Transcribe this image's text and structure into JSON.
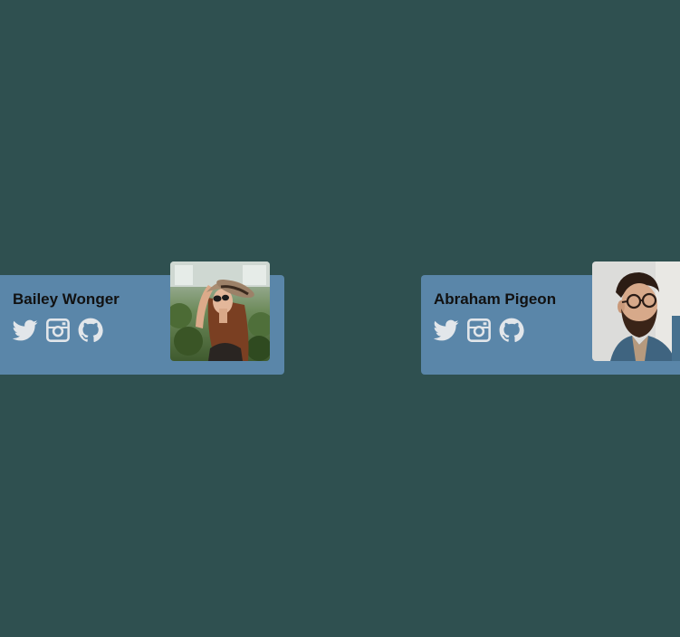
{
  "colors": {
    "background": "#2f5050",
    "card": "#5a86a9",
    "icon": "#e2e6ea",
    "name_text": "#111111"
  },
  "cards": [
    {
      "name": "Bailey Wonger",
      "socials": [
        "twitter-icon",
        "instagram-icon",
        "github-icon"
      ],
      "avatar": "woman-in-hat-photo"
    },
    {
      "name": "Abraham Pigeon",
      "socials": [
        "twitter-icon",
        "instagram-icon",
        "github-icon"
      ],
      "avatar": "bearded-man-with-glasses-photo"
    }
  ]
}
